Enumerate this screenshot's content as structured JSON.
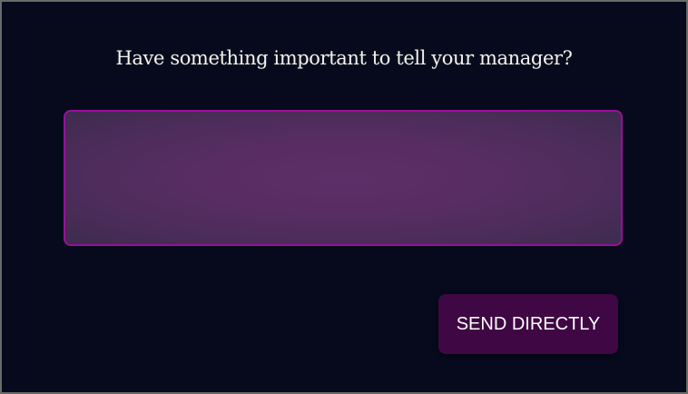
{
  "prompt": {
    "text": "Have something important to tell your manager?"
  },
  "message": {
    "value": ""
  },
  "send_button": {
    "label": "SEND DIRECTLY"
  },
  "colors": {
    "background": "#060a1c",
    "textarea_border": "#9a0f9a",
    "button": "#3f0844"
  }
}
